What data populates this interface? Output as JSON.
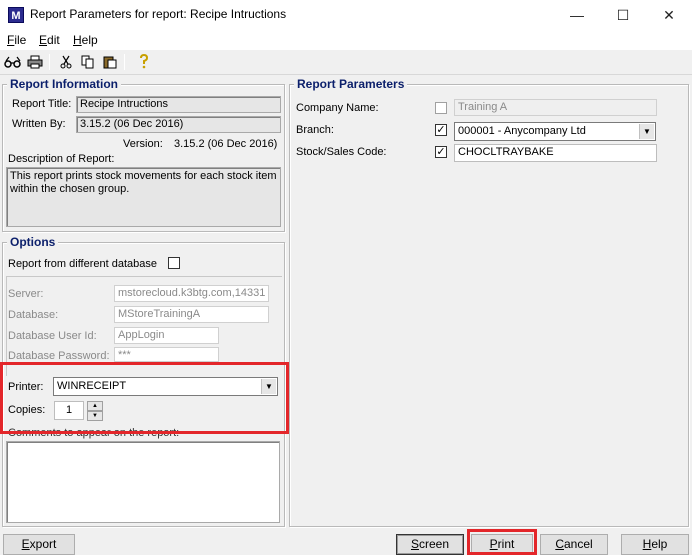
{
  "window": {
    "app_icon": "M",
    "title": "Report Parameters for report: Recipe Intructions",
    "minimize": "—",
    "maximize": "☐",
    "close": "✕"
  },
  "menu": [
    {
      "label": "File",
      "mnemonic": "F",
      "rest": "ile"
    },
    {
      "label": "Edit",
      "mnemonic": "E",
      "rest": "dit"
    },
    {
      "label": "Help",
      "mnemonic": "H",
      "rest": "elp"
    }
  ],
  "toolbar": {
    "icons": [
      "preview-icon",
      "print-icon",
      "cut-icon",
      "copy-icon",
      "paste-icon",
      "help-icon"
    ]
  },
  "report_info": {
    "legend": "Report Information",
    "title_label": "Report Title:",
    "title_value": "Recipe Intructions",
    "written_label": "Written By:",
    "written_value": "3.15.2 (06 Dec 2016)",
    "version_label": "Version:",
    "version_value": "3.15.2 (06 Dec 2016)",
    "desc_label": "Description of Report:",
    "desc_value": "This report prints stock movements for each stock item within the chosen group."
  },
  "options": {
    "legend": "Options",
    "diff_db_label": "Report from different database",
    "diff_db_checked": false,
    "server_label": "Server:",
    "server_value": "mstorecloud.k3btg.com,14331",
    "database_label": "Database:",
    "database_value": "MStoreTrainingA",
    "user_label": "Database User Id:",
    "user_value": "AppLogin",
    "password_label": "Database Password:",
    "password_value": "***",
    "printer_label": "Printer:",
    "printer_value": "WINRECEIPT",
    "copies_label": "Copies:",
    "copies_value": "1",
    "comments_label": "Comments to appear on the report:"
  },
  "params": {
    "legend": "Report Parameters",
    "company_label": "Company Name:",
    "company_checked": false,
    "company_value": "Training A",
    "branch_label": "Branch:",
    "branch_checked": true,
    "branch_value": "000001 - Anycompany Ltd",
    "stock_label": "Stock/Sales Code:",
    "stock_checked": true,
    "stock_value": "CHOCLTRAYBAKE"
  },
  "buttons": {
    "export": {
      "mnemonic": "E",
      "rest": "xport"
    },
    "screen": {
      "mnemonic": "S",
      "rest": "creen"
    },
    "print": {
      "mnemonic": "P",
      "rest": "rint"
    },
    "cancel": {
      "mnemonic": "C",
      "rest": "ancel"
    },
    "help": {
      "mnemonic": "H",
      "rest": "elp"
    }
  },
  "highlight_color": "#e3262a"
}
